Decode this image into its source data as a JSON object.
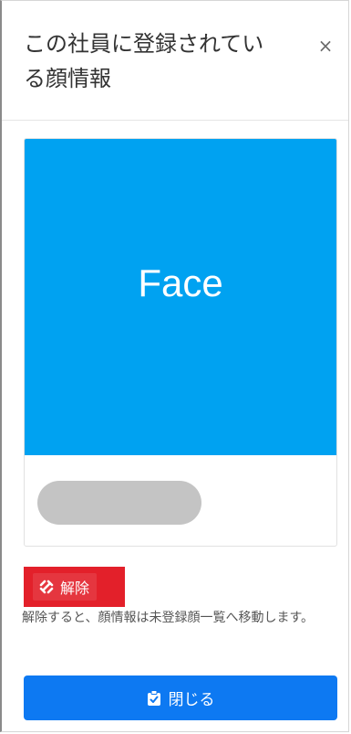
{
  "dialog": {
    "title": "この社員に登録されている顔情報",
    "close_symbol": "×"
  },
  "face_card": {
    "image_label": "Face",
    "image_color": "#00a2f1",
    "placeholder_color": "#c4c4c4"
  },
  "release": {
    "icon": "unlink-icon",
    "label": "解除",
    "color": "#e3202a"
  },
  "note": "解除すると、顔情報は未登録顔一覧へ移動します。",
  "footer": {
    "icon": "clipboard-check-icon",
    "close_label": "閉じる",
    "color": "#0d79f2"
  }
}
